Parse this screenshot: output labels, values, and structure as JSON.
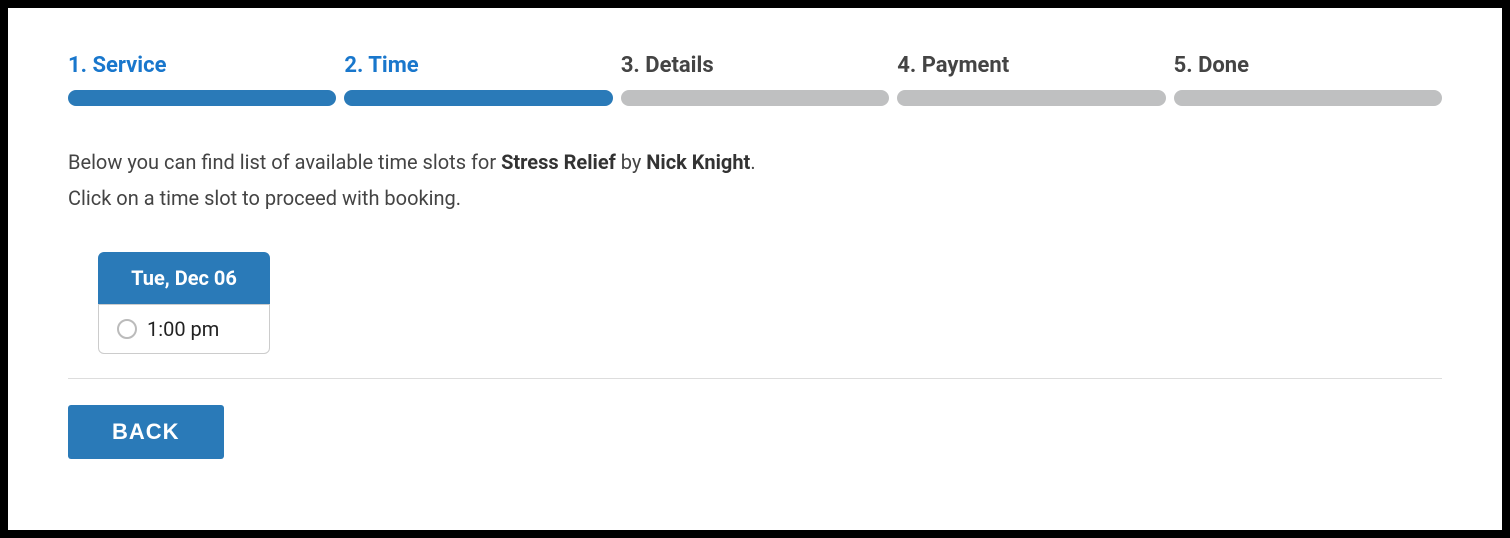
{
  "steps": [
    {
      "label": "1. Service",
      "active": true
    },
    {
      "label": "2. Time",
      "active": true
    },
    {
      "label": "3. Details",
      "active": false
    },
    {
      "label": "4. Payment",
      "active": false
    },
    {
      "label": "5. Done",
      "active": false
    }
  ],
  "intro": {
    "prefix": "Below you can find list of available time slots for ",
    "service": "Stress Relief",
    "by": " by ",
    "provider": "Nick Knight",
    "suffix": ".",
    "line2": "Click on a time slot to proceed with booking."
  },
  "date_header": "Tue, Dec 06",
  "slots": [
    {
      "time": "1:00 pm"
    }
  ],
  "back_label": "BACK"
}
